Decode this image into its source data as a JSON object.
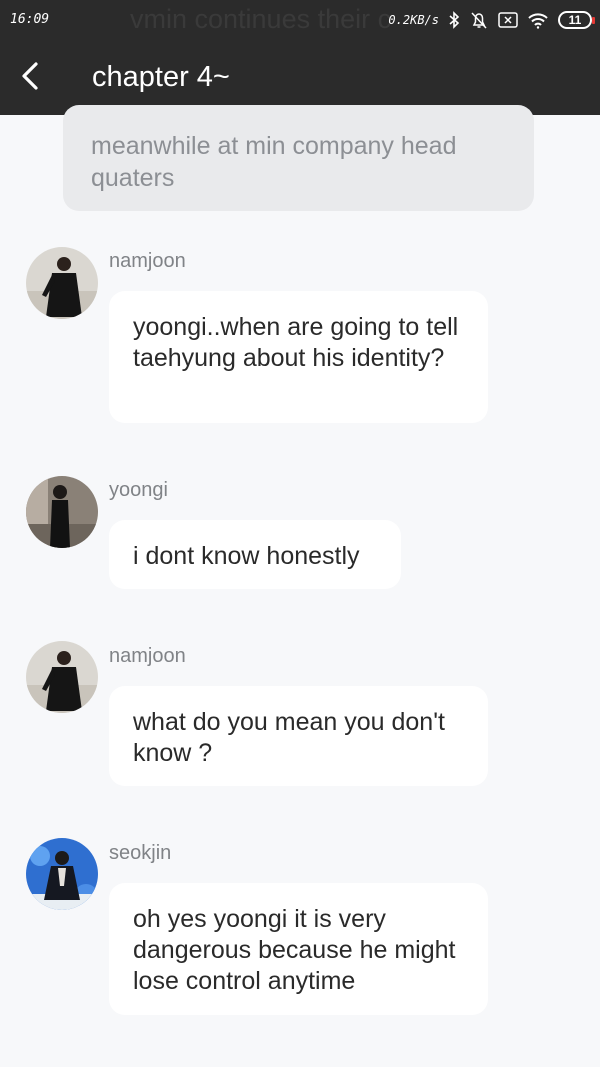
{
  "status_bar": {
    "time": "16:09",
    "network_speed": "0.2KB/s",
    "battery_level": "11",
    "background_text": "vmin continues their c",
    "icons": [
      "bluetooth-icon",
      "alarm-off-icon",
      "sim-x-icon",
      "wifi-icon",
      "battery-icon"
    ]
  },
  "header": {
    "title": "chapter 4~",
    "back_icon": "chevron-left-icon"
  },
  "narration": {
    "text": "meanwhile at min company head quaters"
  },
  "messages": [
    {
      "sender": "namjoon",
      "text": "yoongi..when are going to tell taehyung about his identity?"
    },
    {
      "sender": "yoongi",
      "text": "i dont know honestly"
    },
    {
      "sender": "namjoon",
      "text": "what do you mean you don't know ?"
    },
    {
      "sender": "seokjin",
      "text": "oh yes yoongi it is very dangerous because he might lose control anytime"
    }
  ],
  "colors": {
    "topbar": "#2b2b2b",
    "background": "#f7f8fa",
    "narration_bubble": "#e9eaec",
    "message_bubble": "#ffffff"
  }
}
